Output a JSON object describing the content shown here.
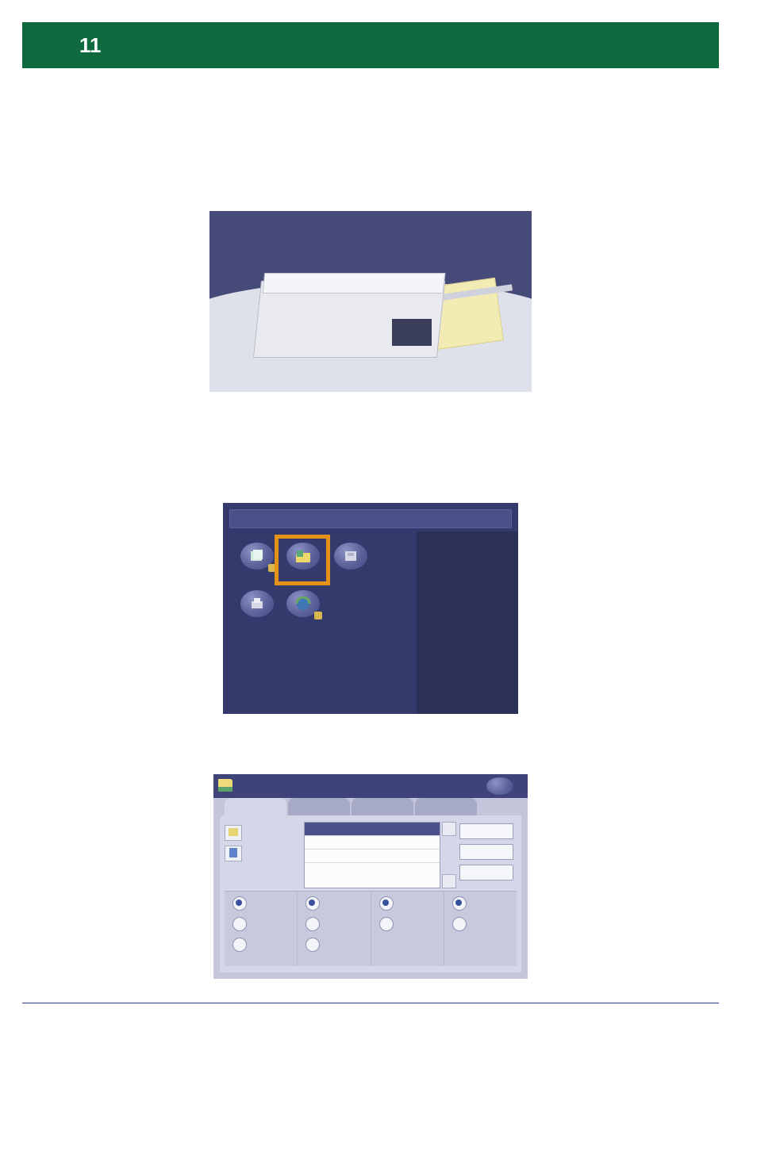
{
  "header": {
    "number": "11"
  },
  "services_icons": [
    {
      "name": "copy-icon",
      "has_lock": true
    },
    {
      "name": "scan-to-folder-icon",
      "has_lock": false,
      "highlighted": true
    },
    {
      "name": "fax-icon",
      "has_lock": false
    },
    {
      "name": "print-icon",
      "has_lock": false
    },
    {
      "name": "internet-services-icon",
      "has_lock": true
    }
  ],
  "settings": {
    "tabs_count": 4,
    "list_rows": 4,
    "side_buttons": [
      "folder",
      "page"
    ],
    "right_buttons": 3,
    "radio_columns": 4,
    "radios_per_column": 3
  }
}
